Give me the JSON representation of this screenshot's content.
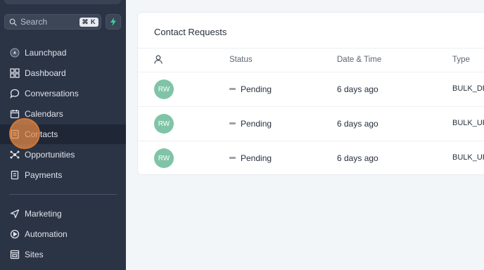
{
  "sidebar": {
    "search_placeholder": "Search",
    "search_shortcut": "⌘ K",
    "nav_primary": [
      {
        "label": "Launchpad",
        "icon": "launchpad-icon"
      },
      {
        "label": "Dashboard",
        "icon": "dashboard-icon"
      },
      {
        "label": "Conversations",
        "icon": "conversations-icon"
      },
      {
        "label": "Calendars",
        "icon": "calendar-icon"
      },
      {
        "label": "Contacts",
        "icon": "contacts-icon",
        "active": true
      },
      {
        "label": "Opportunities",
        "icon": "opportunities-icon"
      },
      {
        "label": "Payments",
        "icon": "payments-icon"
      }
    ],
    "nav_secondary": [
      {
        "label": "Marketing",
        "icon": "marketing-icon"
      },
      {
        "label": "Automation",
        "icon": "automation-icon"
      },
      {
        "label": "Sites",
        "icon": "sites-icon"
      }
    ]
  },
  "main": {
    "card_title": "Contact Requests",
    "columns": [
      "Status",
      "Date & Time",
      "Type"
    ],
    "rows": [
      {
        "avatar": "RW",
        "status": "Pending",
        "datetime": "6 days ago",
        "type": "BULK_DE"
      },
      {
        "avatar": "RW",
        "status": "Pending",
        "datetime": "6 days ago",
        "type": "BULK_UP"
      },
      {
        "avatar": "RW",
        "status": "Pending",
        "datetime": "6 days ago",
        "type": "BULK_UP"
      }
    ]
  },
  "colors": {
    "sidebar_bg": "#2b3445",
    "sidebar_active_bg": "#1f2736",
    "avatar_bg": "#7fc4a6",
    "accent_green": "#36d399",
    "cursor": "#e98c46"
  }
}
